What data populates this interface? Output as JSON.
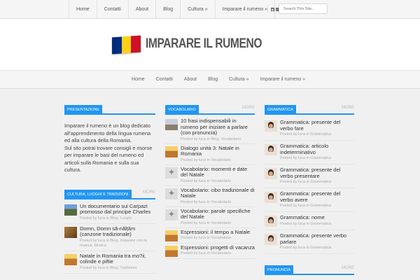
{
  "topnav": {
    "items": [
      "Home",
      "Contatti",
      "About",
      "Blog",
      "Cultura »",
      "Imparare il rumeno »"
    ]
  },
  "social_icons": [
    "rss-icon",
    "facebook-icon"
  ],
  "search": {
    "placeholder": "Search This Site..."
  },
  "site": {
    "title": "IMPARARE IL RUMENO"
  },
  "colors": {
    "accent": "#2196f3",
    "flag_blue": "#002b7f",
    "flag_yellow": "#fcd116",
    "flag_red": "#ce1126"
  },
  "mainnav": {
    "items": [
      "Home",
      "Contatti",
      "About",
      "Blog",
      "Cultura »",
      "Imparare il rumeno »"
    ]
  },
  "presentazione": {
    "tab": "PRESENTAZIONE",
    "paragraphs": [
      "Imparare il rumeno è un blog dedicato all'apprendimento della lingua rumena ed alla cultura della Romania.",
      "Sul sito potrai trovare consigli e risorse per imparare le basi del rumeno ed articoli sulla Romania e sulla sua cultura."
    ]
  },
  "cultura": {
    "tab": "CULTURA, LUOGHI E TRADIZIONI",
    "more": "MORE",
    "posts": [
      {
        "title": "Un documentario sui Carpazi promosso dal principe Charles",
        "meta": "Posted by luca in Blog, Luoghi"
      },
      {
        "title": "Domn, Domn să-nălțăm (canzone tradizionale)",
        "meta": "Posted by luca in Blog, Imparare con la musica, Musica"
      },
      {
        "title": "Natale in Romania tra mo?ii, colinde e piftie",
        "meta": "Posted by luca in Blog, Tradizioni"
      }
    ]
  },
  "vocabolario": {
    "tab": "VOCABOLARIO",
    "more": "MORE",
    "posts": [
      {
        "title": "10 frasi indispensabili in rumeno per iniziare a parlare (con pronuncia)",
        "meta": "Posted by luca in Blog, Vocabolario"
      },
      {
        "title": "Dialogo unità 3: Natale in Romania",
        "meta": "Posted by luca in Vocabolario"
      },
      {
        "title": "Vocabolario: momenti e date del Natale",
        "meta": "Posted by luca in Vocabolario"
      },
      {
        "title": "Vocabolario: cibo tradizionale di Natale",
        "meta": "Posted by luca in Vocabolario"
      },
      {
        "title": "Vocabolario: parole specifiche del Natale",
        "meta": "Posted by luca in Vocabolario"
      },
      {
        "title": "Espressioni: il tempo a Natale",
        "meta": "Posted by luca in Vocabolario"
      },
      {
        "title": "Espressioni: progetti di vacanza",
        "meta": "Posted by luca in Vocabolario"
      }
    ]
  },
  "grammatica": {
    "tab": "GRAMMATICA",
    "more": "MORE",
    "posts": [
      {
        "title": "Grammatica: presente del verbo fare",
        "meta": "Posted by luca in Grammatica"
      },
      {
        "title": "Grammatica: articolo indeterminativo",
        "meta": "Posted by luca in Grammatica"
      },
      {
        "title": "Grammatica: presente del verbo presentare",
        "meta": "Posted by luca in Grammatica"
      },
      {
        "title": "Grammatica: presente del verbo avere",
        "meta": "Posted by luca in Grammatica"
      },
      {
        "title": "Grammatica: nome",
        "meta": "Posted by luca in Grammatica"
      },
      {
        "title": "Grammatica: presente verbo parlare",
        "meta": "Posted by luca in Grammatica"
      }
    ]
  },
  "pronuncia": {
    "tab": "PRONUNCIA",
    "more": "MORE"
  }
}
